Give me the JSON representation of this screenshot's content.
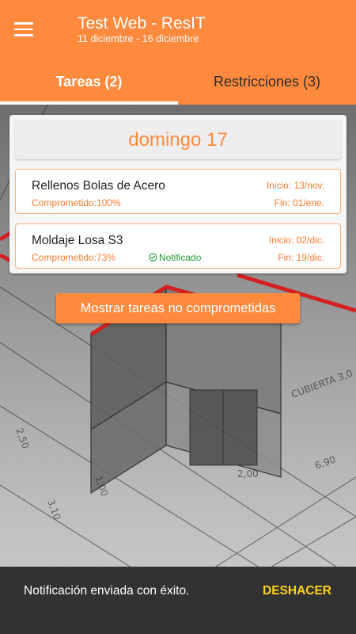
{
  "header": {
    "title": "Test Web - ResIT",
    "subtitle": "11 diciembre - 16 diciembre",
    "menu_icon": "hamburger-menu-icon"
  },
  "tabs": [
    {
      "label": "Tareas (2)",
      "active": true
    },
    {
      "label": "Restricciones (3)",
      "active": false
    }
  ],
  "day": {
    "title": "domingo 17",
    "tasks": [
      {
        "name": "Rellenos Bolas de Acero",
        "committed": "Comprometido:100%",
        "start": "Inicio: 13/nov.",
        "end": "Fin: 01/ene.",
        "notified": ""
      },
      {
        "name": "Moldaje Losa S3",
        "committed": "Comprometido:73%",
        "start": "Inicio: 02/dic.",
        "end": "Fin: 19/dic.",
        "notified": "Notificado"
      }
    ]
  },
  "show_button": "Mostrar tareas no comprometidas",
  "snackbar": {
    "message": "Notificación enviada con éxito.",
    "action": "DESHACER"
  },
  "colors": {
    "accent": "#ff8a3d",
    "notified": "#1f9d3a",
    "snackbar_bg": "#323232",
    "snackbar_action": "#ffd21f"
  }
}
